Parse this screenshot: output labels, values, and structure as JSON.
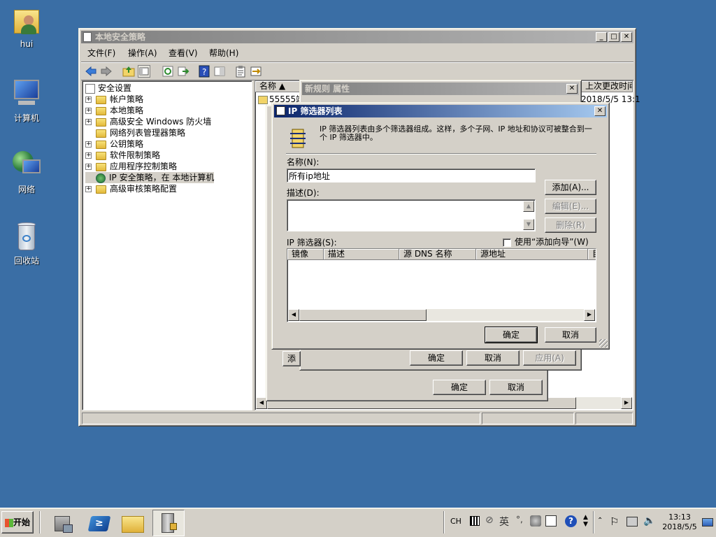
{
  "desktop": {
    "icons": [
      {
        "label": "hui",
        "icon": "user-folder-icon"
      },
      {
        "label": "计算机",
        "icon": "computer-icon"
      },
      {
        "label": "网络",
        "icon": "network-icon"
      },
      {
        "label": "回收站",
        "icon": "recycle-bin-icon"
      }
    ]
  },
  "main_window": {
    "title": "本地安全策略",
    "menu": [
      "文件(F)",
      "操作(A)",
      "查看(V)",
      "帮助(H)"
    ],
    "tree": {
      "root": "安全设置",
      "items": [
        "帐户策略",
        "本地策略",
        "高级安全 Windows 防火墙",
        "网络列表管理器策略",
        "公钥策略",
        "软件限制策略",
        "应用程序控制策略",
        "IP 安全策略，在 本地计算机",
        "高级审核策略配置"
      ]
    },
    "list": {
      "col_name": "名称",
      "col_last_modified": "上次更改时间",
      "row_name": "55555端",
      "row_time": "2018/5/5 13:1"
    }
  },
  "props_dialog": {
    "title": "新规则 属性",
    "add_label": "添",
    "ok": "确定",
    "cancel": "取消",
    "apply": "应用(A)"
  },
  "back_dialog": {
    "ok": "确定",
    "cancel": "取消"
  },
  "ipfilter_dialog": {
    "title": "IP 筛选器列表",
    "description": "IP 筛选器列表由多个筛选器组成。这样，多个子网、IP 地址和协议可被整合到一个 IP 筛选器中。",
    "name_label": "名称(N):",
    "name_value": "所有ip地址",
    "desc_label": "描述(D):",
    "desc_value": "",
    "add_button": "添加(A)...",
    "edit_button": "编辑(E)...",
    "delete_button": "删除(R)",
    "filters_label": "IP 筛选器(S):",
    "wizard_checkbox": "使用“添加向导”(W)",
    "wizard_checked": false,
    "columns": [
      "镜像",
      "描述",
      "源 DNS 名称",
      "源地址",
      "目"
    ],
    "ok": "确定",
    "cancel": "取消"
  },
  "taskbar": {
    "start": "开始",
    "lang": "CH",
    "ime": "英",
    "time": "13:13",
    "date": "2018/5/5"
  }
}
